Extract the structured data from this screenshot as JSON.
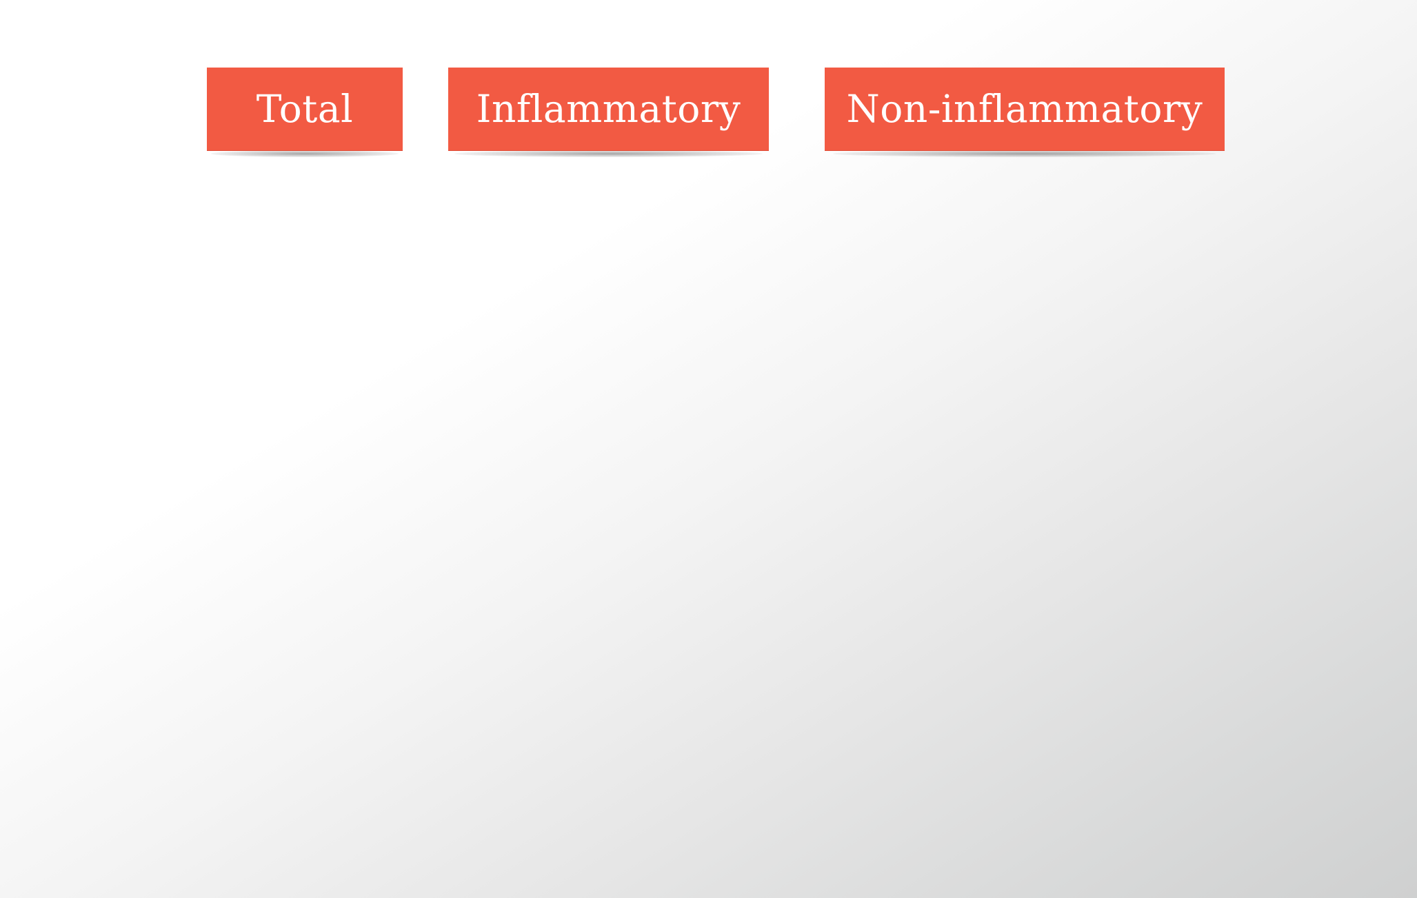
{
  "labels": {
    "total": "Total",
    "inflammatory": "Inflammatory",
    "non_inflammatory": "Non-inflammatory"
  },
  "colors": {
    "label_background": "#f25a43",
    "label_text": "#ffffff"
  }
}
